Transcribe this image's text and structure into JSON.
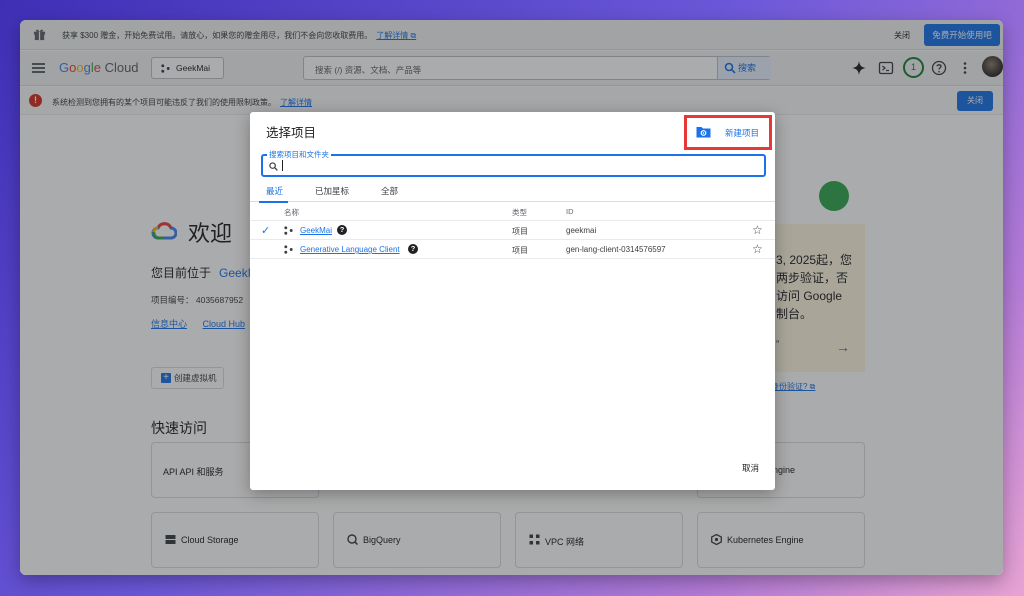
{
  "promo": {
    "text": "获享 $300 赠金，开始免费试用。请放心，如果您的赠金用尽，我们不会向您收取费用。",
    "link": "了解详情 ⧉",
    "close": "关闭",
    "cta": "免费开始使用吧"
  },
  "header": {
    "logo_parts": [
      "G",
      "o",
      "o",
      "g",
      "l",
      "e"
    ],
    "logo_suffix": " Cloud",
    "project": "GeekMai",
    "search_placeholder": "搜索 (/) 资源、文档、产品等",
    "search_button": "搜索",
    "notifications_count": "1"
  },
  "warning": {
    "text": "系统检测到您拥有的某个项目可能违反了我们的使用限制政策。",
    "link": "了解详情",
    "close": "关闭"
  },
  "page": {
    "welcome": "欢迎",
    "current_location": "您目前位于",
    "current_project": "GeekM",
    "project_number": "项目编号：  4035687952",
    "links": [
      "信息中心",
      "Cloud Hub"
    ],
    "create_vm": "创建虚拟机",
    "quick_access": "快速访问",
    "cards": [
      "API API 和服务",
      "Cloud Storage",
      "BigQuery",
      "VPC 网络",
      "Kubernetes Engine",
      "Engine"
    ],
    "notice_lines": [
      "3, 2025起，您",
      "两步验证，否",
      "访问 Google",
      "制台。"
    ],
    "notice_quote": "”",
    "mfa_link": "身份验证? ⧉"
  },
  "dialog": {
    "title": "选择项目",
    "new_project": "新建项目",
    "search_label": "搜索项目和文件夹",
    "tabs": [
      "最近",
      "已加星标",
      "全部"
    ],
    "columns": [
      "名称",
      "类型",
      "ID"
    ],
    "rows": [
      {
        "name": "GeekMai",
        "type": "项目",
        "id": "geekmai",
        "selected": true
      },
      {
        "name": "Generative Language Client",
        "type": "项目",
        "id": "gen-lang-client-0314576597",
        "selected": false
      }
    ],
    "cancel": "取消"
  },
  "colors": {
    "accent": "#1a73e8",
    "highlight": "#e53935",
    "warning": "#d93025"
  }
}
